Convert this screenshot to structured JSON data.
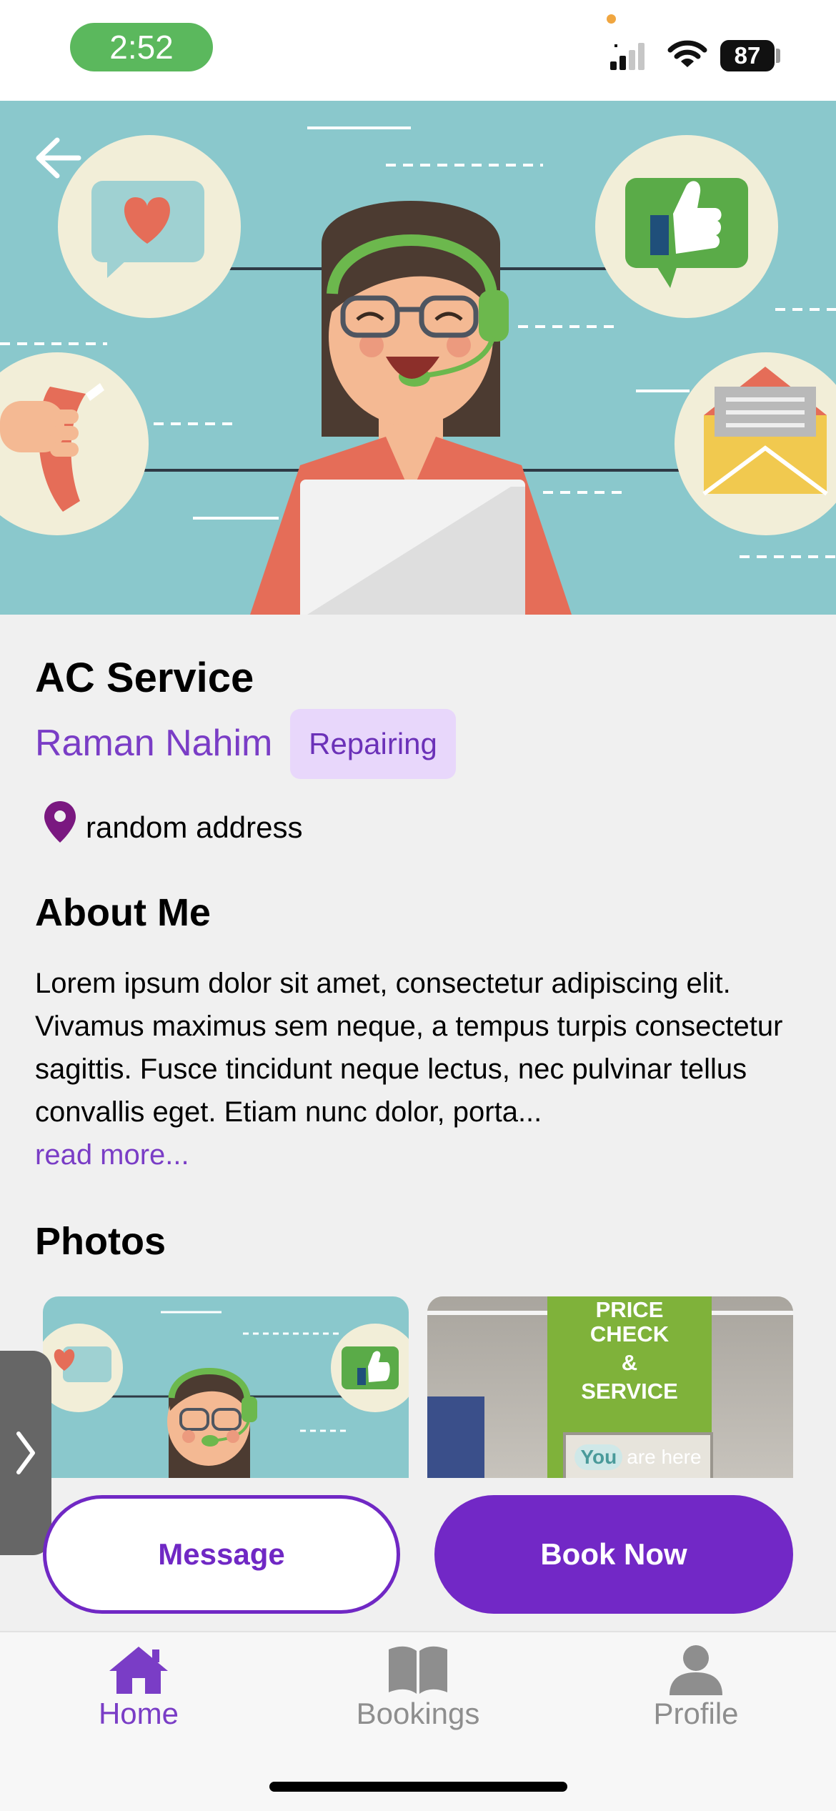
{
  "status": {
    "time": "2:52",
    "battery": "87"
  },
  "service": {
    "title": "AC Service",
    "provider": "Raman Nahim",
    "category": "Repairing",
    "address": "random address"
  },
  "about": {
    "title": "About Me",
    "text": "Lorem ipsum dolor sit amet, consectetur adipiscing elit. Vivamus maximus sem neque, a tempus turpis consectetur sagittis. Fusce tincidunt neque lectus, nec pulvinar tellus convallis eget. Etiam nunc dolor, porta...",
    "read_more": "read more..."
  },
  "photos": {
    "title": "Photos",
    "sign_line1": "PRICE",
    "sign_line2": "CHECK",
    "sign_line3": "&",
    "sign_line4": "SERVICE",
    "sign_here_you": "You",
    "sign_here_rest": "are here"
  },
  "actions": {
    "message": "Message",
    "book": "Book Now"
  },
  "tabs": [
    {
      "label": "Home",
      "icon": "home-icon",
      "active": true
    },
    {
      "label": "Bookings",
      "icon": "book-icon",
      "active": false
    },
    {
      "label": "Profile",
      "icon": "person-icon",
      "active": false
    }
  ],
  "colors": {
    "accent": "#7228c6",
    "badge_bg": "#e8d7fb",
    "hero_bg": "#8ac8cc",
    "time_pill": "#5bb85d"
  }
}
